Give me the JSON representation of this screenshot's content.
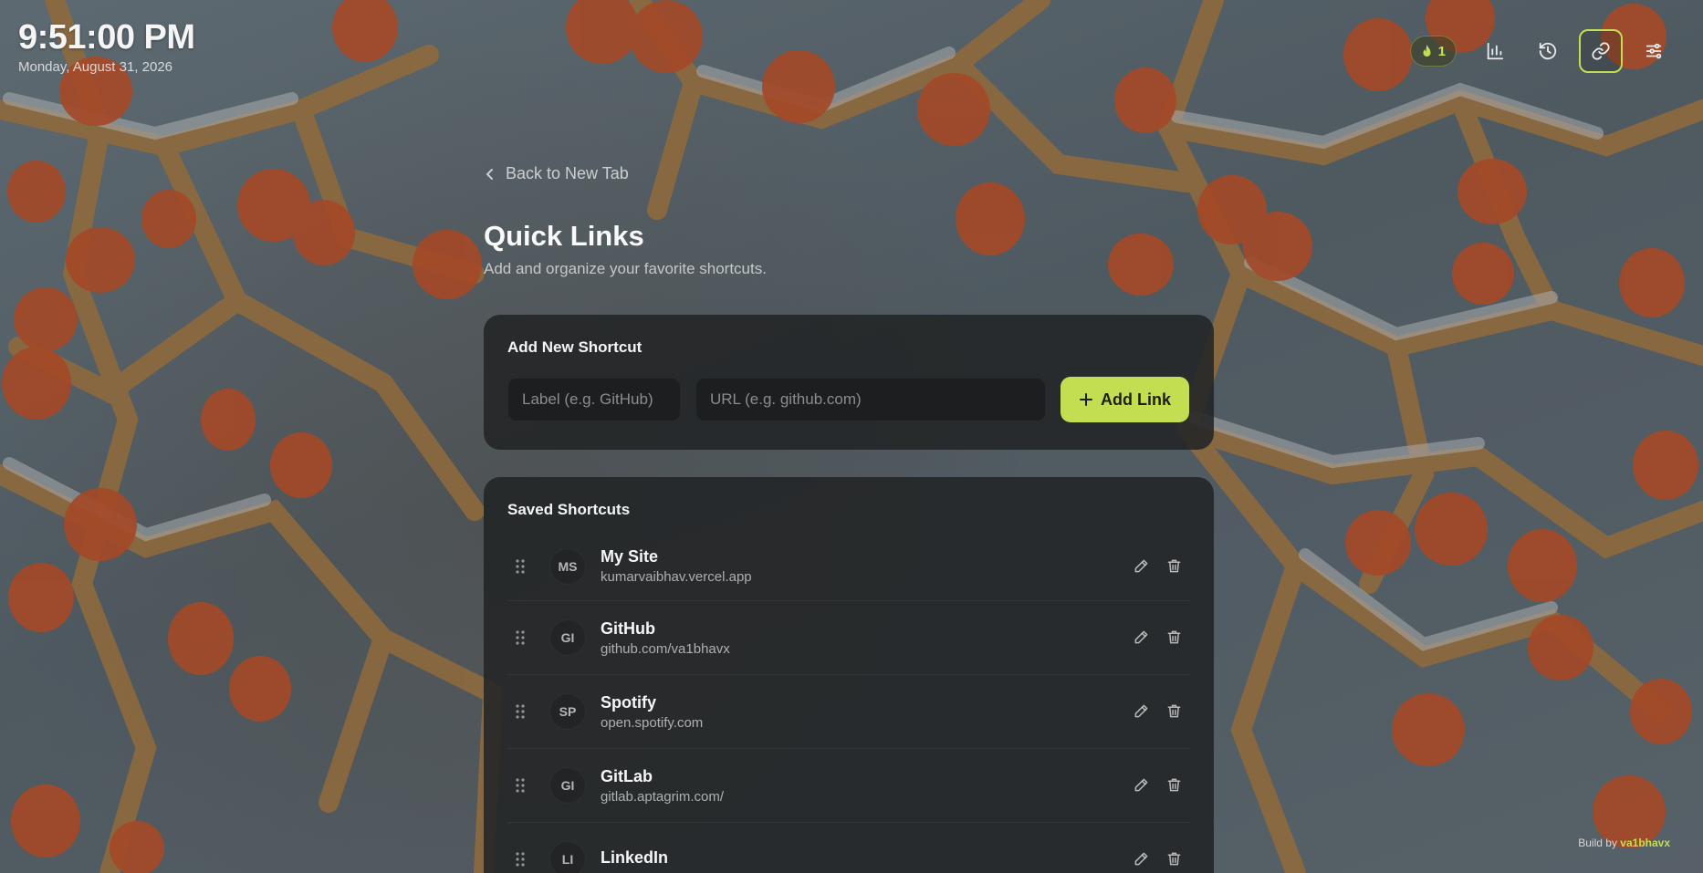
{
  "clock": {
    "time": "9:51:00 PM",
    "date": "Monday, August 31, 2026"
  },
  "toolbar": {
    "streak_count": "1",
    "icons": [
      "flame-icon",
      "bar-chart-icon",
      "history-icon",
      "link-icon",
      "sliders-icon"
    ],
    "accent": "#c4de52"
  },
  "nav": {
    "back_label": "Back to New Tab"
  },
  "page": {
    "title": "Quick Links",
    "subtitle": "Add and organize your favorite shortcuts."
  },
  "add_card": {
    "heading": "Add New Shortcut",
    "label_placeholder": "Label (e.g. GitHub)",
    "url_placeholder": "URL (e.g. github.com)",
    "add_button_label": "Add Link"
  },
  "saved": {
    "heading": "Saved Shortcuts",
    "items": [
      {
        "initials": "MS",
        "name": "My Site",
        "url": "kumarvaibhav.vercel.app"
      },
      {
        "initials": "GI",
        "name": "GitHub",
        "url": "github.com/va1bhavx"
      },
      {
        "initials": "SP",
        "name": "Spotify",
        "url": "open.spotify.com"
      },
      {
        "initials": "GI",
        "name": "GitLab",
        "url": "gitlab.aptagrim.com/"
      },
      {
        "initials": "LI",
        "name": "LinkedIn",
        "url": ""
      }
    ]
  },
  "footer": {
    "credit_prefix": "Build by",
    "credit_name": "va1bhavx"
  }
}
